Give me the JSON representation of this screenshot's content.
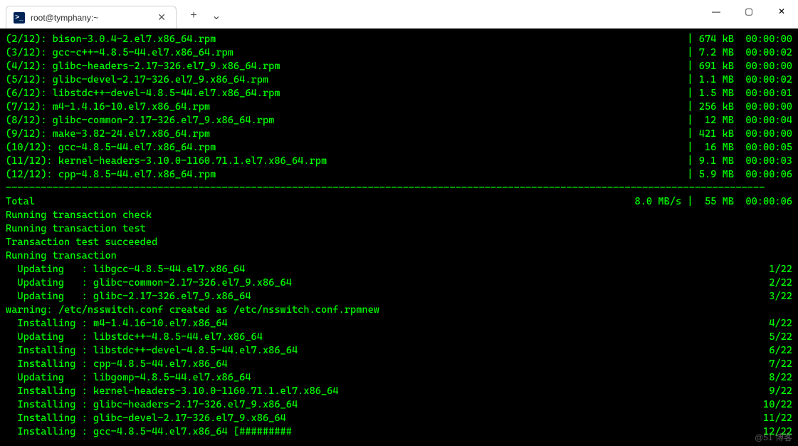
{
  "window": {
    "tab_title": "root@tymphany:~",
    "ps_icon_text": ">_",
    "new_tab_label": "+",
    "dropdown_label": "⌄",
    "min_label": "—",
    "max_label": "▢",
    "close_label": "✕",
    "tab_close_label": "✕"
  },
  "downloads": [
    {
      "idx": "(2/12):",
      "pkg": "bison-3.0.4-2.el7.x86_64.rpm",
      "size": "674 kB",
      "time": "00:00:00"
    },
    {
      "idx": "(3/12):",
      "pkg": "gcc-c++-4.8.5-44.el7.x86_64.rpm",
      "size": "7.2 MB",
      "time": "00:00:02"
    },
    {
      "idx": "(4/12):",
      "pkg": "glibc-headers-2.17-326.el7_9.x86_64.rpm",
      "size": "691 kB",
      "time": "00:00:00"
    },
    {
      "idx": "(5/12):",
      "pkg": "glibc-devel-2.17-326.el7_9.x86_64.rpm",
      "size": "1.1 MB",
      "time": "00:00:02"
    },
    {
      "idx": "(6/12):",
      "pkg": "libstdc++-devel-4.8.5-44.el7.x86_64.rpm",
      "size": "1.5 MB",
      "time": "00:00:01"
    },
    {
      "idx": "(7/12):",
      "pkg": "m4-1.4.16-10.el7.x86_64.rpm",
      "size": "256 kB",
      "time": "00:00:00"
    },
    {
      "idx": "(8/12):",
      "pkg": "glibc-common-2.17-326.el7_9.x86_64.rpm",
      "size": " 12 MB",
      "time": "00:00:04"
    },
    {
      "idx": "(9/12):",
      "pkg": "make-3.82-24.el7.x86_64.rpm",
      "size": "421 kB",
      "time": "00:00:00"
    },
    {
      "idx": "(10/12):",
      "pkg": "gcc-4.8.5-44.el7.x86_64.rpm",
      "size": " 16 MB",
      "time": "00:00:05"
    },
    {
      "idx": "(11/12):",
      "pkg": "kernel-headers-3.10.0-1160.71.1.el7.x86_64.rpm",
      "size": "9.1 MB",
      "time": "00:00:03"
    },
    {
      "idx": "(12/12):",
      "pkg": "cpp-4.8.5-44.el7.x86_64.rpm",
      "size": "5.9 MB",
      "time": "00:00:06"
    }
  ],
  "total": {
    "label": "Total",
    "rate": "8.0 MB/s",
    "size": " 55 MB",
    "time": "00:00:06"
  },
  "status_lines": [
    "Running transaction check",
    "Running transaction test",
    "Transaction test succeeded",
    "Running transaction"
  ],
  "transactions": [
    {
      "action": "Updating  ",
      "pkg": "libgcc-4.8.5-44.el7.x86_64",
      "count": "1/22"
    },
    {
      "action": "Updating  ",
      "pkg": "glibc-common-2.17-326.el7_9.x86_64",
      "count": "2/22"
    },
    {
      "action": "Updating  ",
      "pkg": "glibc-2.17-326.el7_9.x86_64",
      "count": "3/22"
    },
    {
      "action": "__warning__",
      "text": "warning: /etc/nsswitch.conf created as /etc/nsswitch.conf.rpmnew"
    },
    {
      "action": "Installing",
      "pkg": "m4-1.4.16-10.el7.x86_64",
      "count": "4/22"
    },
    {
      "action": "Updating  ",
      "pkg": "libstdc++-4.8.5-44.el7.x86_64",
      "count": "5/22"
    },
    {
      "action": "Installing",
      "pkg": "libstdc++-devel-4.8.5-44.el7.x86_64",
      "count": "6/22"
    },
    {
      "action": "Installing",
      "pkg": "cpp-4.8.5-44.el7.x86_64",
      "count": "7/22"
    },
    {
      "action": "Updating  ",
      "pkg": "libgomp-4.8.5-44.el7.x86_64",
      "count": "8/22"
    },
    {
      "action": "Installing",
      "pkg": "kernel-headers-3.10.0-1160.71.1.el7.x86_64",
      "count": "9/22"
    },
    {
      "action": "Installing",
      "pkg": "glibc-headers-2.17-326.el7_9.x86_64",
      "count": "10/22"
    },
    {
      "action": "Installing",
      "pkg": "glibc-devel-2.17-326.el7_9.x86_64",
      "count": "11/22"
    },
    {
      "action": "Installing",
      "pkg": "gcc-4.8.5-44.el7.x86_64 [#########",
      "count": "12/22"
    }
  ],
  "watermark": "@51 博客"
}
